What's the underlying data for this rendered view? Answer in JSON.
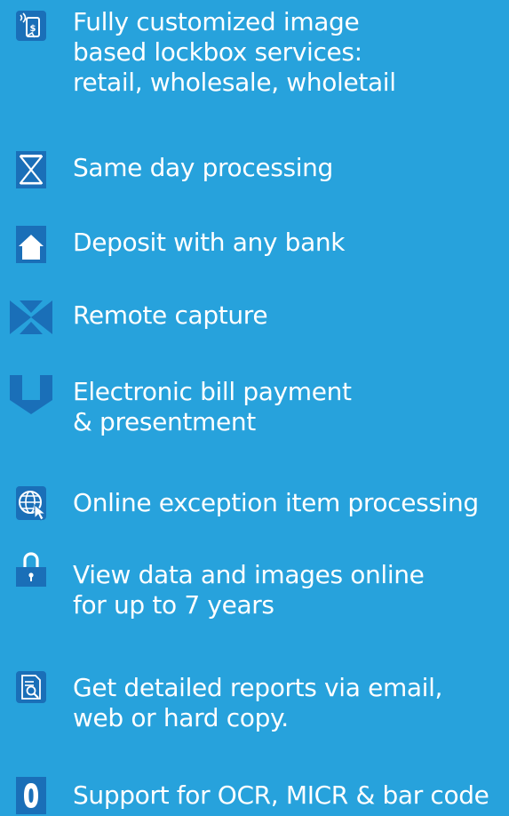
{
  "colors": {
    "background": "#27a2dc",
    "icon_fill": "#1a6fb8",
    "text": "#ffffff"
  },
  "features": [
    {
      "icon": "mobile-deposit-icon",
      "lines": [
        "Fully customized image",
        "based lockbox services:",
        "retail, wholesale, wholetail"
      ]
    },
    {
      "icon": "hourglass-icon",
      "lines": [
        "Same day processing"
      ]
    },
    {
      "icon": "home-icon",
      "lines": [
        "Deposit with any bank"
      ]
    },
    {
      "icon": "remote-capture-icon",
      "lines": [
        "Remote capture"
      ]
    },
    {
      "icon": "download-arrow-icon",
      "lines": [
        "Electronic bill payment",
        "& presentment"
      ]
    },
    {
      "icon": "globe-cursor-icon",
      "lines": [
        "Online exception item processing"
      ]
    },
    {
      "icon": "padlock-icon",
      "lines": [
        "View data and images online",
        " for up to 7 years"
      ]
    },
    {
      "icon": "report-magnifier-icon",
      "lines": [
        "Get detailed reports via email,",
        "web or hard copy."
      ]
    },
    {
      "icon": "ocr-zero-icon",
      "lines": [
        "Support for OCR, MICR & bar code"
      ]
    }
  ]
}
